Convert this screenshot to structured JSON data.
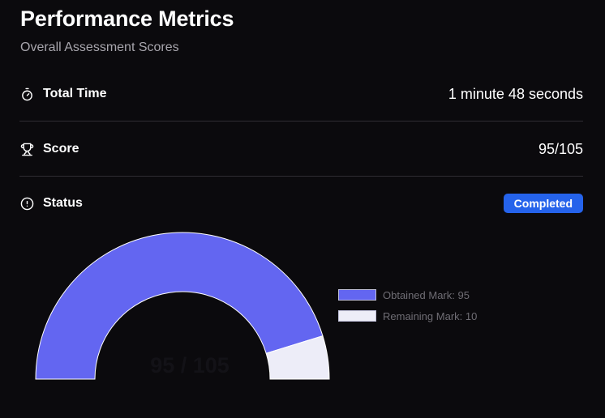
{
  "header": {
    "title": "Performance Metrics",
    "subtitle": "Overall Assessment Scores"
  },
  "metrics": {
    "total_time": {
      "label": "Total Time",
      "value": "1 minute 48 seconds",
      "icon": "stopwatch-icon"
    },
    "score": {
      "label": "Score",
      "value": "95/105",
      "icon": "trophy-icon"
    },
    "status": {
      "label": "Status",
      "value": "Completed",
      "icon": "alert-circle-icon"
    }
  },
  "colors": {
    "obtained": "#6366f1",
    "remaining": "#ededf8",
    "badge": "#2563eb"
  },
  "chart_data": {
    "type": "pie",
    "subtype": "semi-donut gauge",
    "center_label": "95 / 105",
    "total": 105,
    "series": [
      {
        "name": "Obtained Mark",
        "value": 95
      },
      {
        "name": "Remaining Mark",
        "value": 10
      }
    ],
    "legend": [
      "Obtained Mark: 95",
      "Remaining Mark: 10"
    ],
    "legend_placement": "right"
  }
}
